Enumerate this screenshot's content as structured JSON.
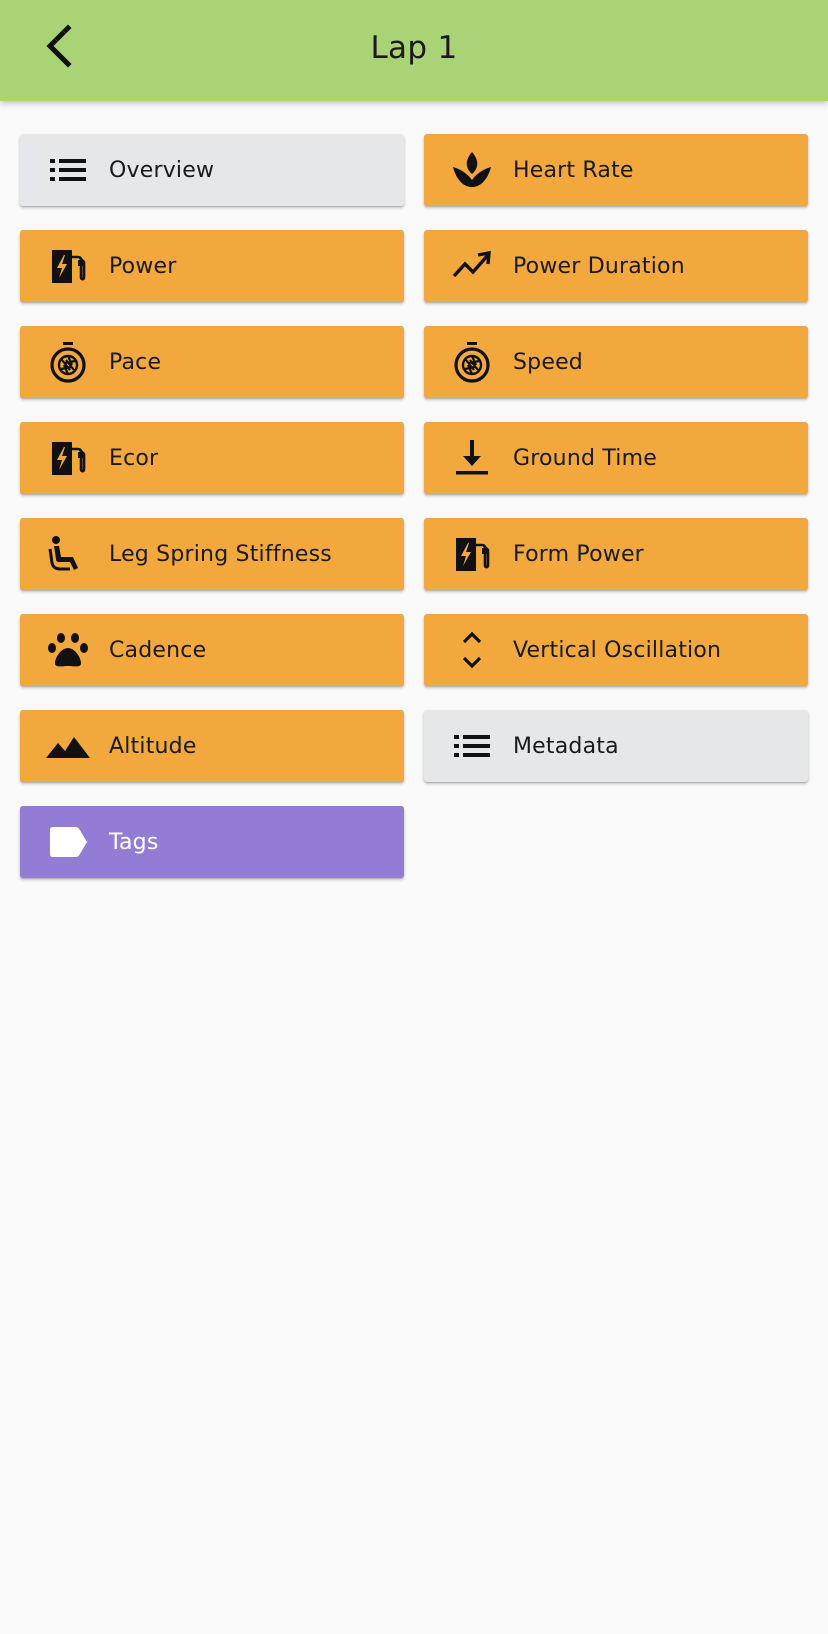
{
  "header": {
    "title": "Lap 1",
    "back_icon": "chevron-left-icon",
    "background": "#aad375"
  },
  "colors": {
    "orange": "#f2a83c",
    "grey": "#e6e7ea",
    "purple": "#937cd6"
  },
  "tiles": [
    {
      "label": "Overview",
      "icon": "list-icon",
      "color": "grey"
    },
    {
      "label": "Heart Rate",
      "icon": "lotus-icon",
      "color": "orange"
    },
    {
      "label": "Power",
      "icon": "ev-station-icon",
      "color": "orange"
    },
    {
      "label": "Power Duration",
      "icon": "trending-up-icon",
      "color": "orange"
    },
    {
      "label": "Pace",
      "icon": "stopwatch-icon",
      "color": "orange"
    },
    {
      "label": "Speed",
      "icon": "stopwatch-icon",
      "color": "orange"
    },
    {
      "label": "Ecor",
      "icon": "ev-station-icon",
      "color": "orange"
    },
    {
      "label": "Ground Time",
      "icon": "download-arrow-icon",
      "color": "orange"
    },
    {
      "label": "Leg Spring Stiffness",
      "icon": "seat-person-icon",
      "color": "orange"
    },
    {
      "label": "Form Power",
      "icon": "ev-station-icon",
      "color": "orange"
    },
    {
      "label": "Cadence",
      "icon": "paw-icon",
      "color": "orange"
    },
    {
      "label": "Vertical Oscillation",
      "icon": "expand-vertical-icon",
      "color": "orange"
    },
    {
      "label": "Altitude",
      "icon": "mountains-icon",
      "color": "orange"
    },
    {
      "label": "Metadata",
      "icon": "list-icon",
      "color": "grey"
    },
    {
      "label": "Tags",
      "icon": "tag-icon",
      "color": "purple"
    }
  ]
}
